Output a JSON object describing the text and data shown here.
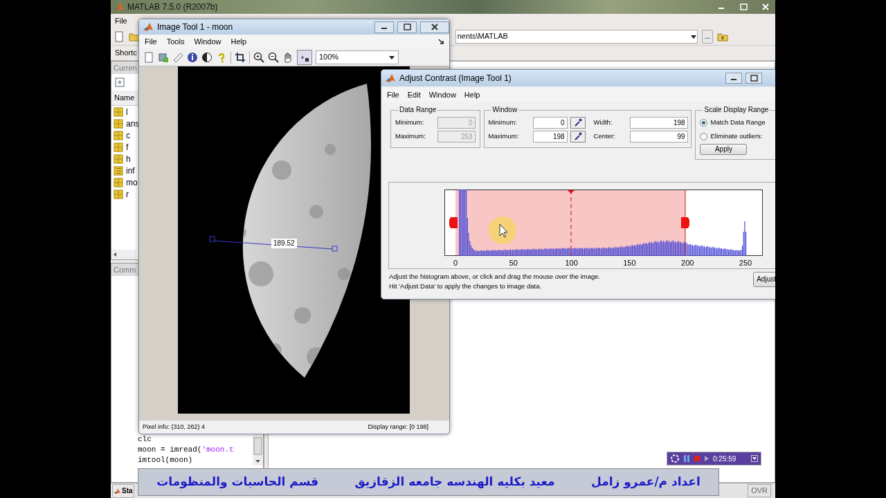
{
  "matlab": {
    "title": "MATLAB  7.5.0 (R2007b)",
    "menu": [
      "File"
    ],
    "current_directory": "nents\\MATLAB",
    "browse_button": "...",
    "shortcuts_label": "Shortc",
    "current_dir_tab": "Curren",
    "workspace": {
      "column": "Name",
      "items": [
        {
          "name": "l",
          "kind": "matrix"
        },
        {
          "name": "ans",
          "kind": "matrix"
        },
        {
          "name": "c",
          "kind": "matrix"
        },
        {
          "name": "f",
          "kind": "matrix"
        },
        {
          "name": "h",
          "kind": "matrix"
        },
        {
          "name": "inf",
          "kind": "struct"
        },
        {
          "name": "mo",
          "kind": "matrix"
        },
        {
          "name": "r",
          "kind": "matrix"
        }
      ]
    },
    "command_history": {
      "title": "Comm",
      "lines": [
        [
          {
            "text": "clc",
            "kind": "code"
          }
        ],
        [
          {
            "text": "moon = imread(",
            "kind": "code"
          },
          {
            "text": "'moon.t",
            "kind": "string"
          }
        ],
        [
          {
            "text": "imtool(moon)",
            "kind": "code"
          }
        ]
      ]
    },
    "start_button": "Sta",
    "status": "OVR"
  },
  "image_tool": {
    "title": "Image Tool 1 - moon",
    "menu": [
      "File",
      "Tools",
      "Window",
      "Help"
    ],
    "zoom": "100%",
    "distance_label": "189.52",
    "pixel_info": "Pixel info: (310, 262)  4",
    "display_range": "Display range: [0 198]"
  },
  "adjust_contrast": {
    "title": "Adjust Contrast (Image Tool 1)",
    "menu": [
      "File",
      "Edit",
      "Window",
      "Help"
    ],
    "data_range": {
      "title": "Data Range",
      "fields": [
        {
          "label": "Minimum:",
          "value": "0",
          "disabled": true
        },
        {
          "label": "Maximum:",
          "value": "253",
          "disabled": true
        }
      ]
    },
    "window": {
      "title": "Window",
      "fields": [
        {
          "label": "Minimum:",
          "value": "0",
          "disabled": false
        },
        {
          "label": "Maximum:",
          "value": "198",
          "disabled": false
        },
        {
          "label": "Width:",
          "value": "198",
          "disabled": false
        },
        {
          "label": "Center:",
          "value": "99",
          "disabled": false
        }
      ]
    },
    "scale_display_range": {
      "title": "Scale Display Range",
      "options": [
        {
          "label": "Match Data Range",
          "selected": true
        },
        {
          "label": "Eliminate outliers:",
          "selected": false
        }
      ],
      "apply": "Apply"
    },
    "histogram": {
      "x_ticks": [
        "0",
        "50",
        "100",
        "150",
        "200",
        "250"
      ]
    },
    "instructions": [
      "Adjust the histogram above, or click and drag the mouse over the image.",
      "Hit 'Adjust Data' to apply the changes to image data."
    ],
    "adjust_button": "Adjust"
  },
  "recorder": {
    "time": "0:25:59"
  },
  "caption": [
    "اعداد  م/عمرو زامل",
    "معيد بكليه الهندسه جامعه الزقازيق",
    "قسم الحاسبات والمنظومات"
  ]
}
